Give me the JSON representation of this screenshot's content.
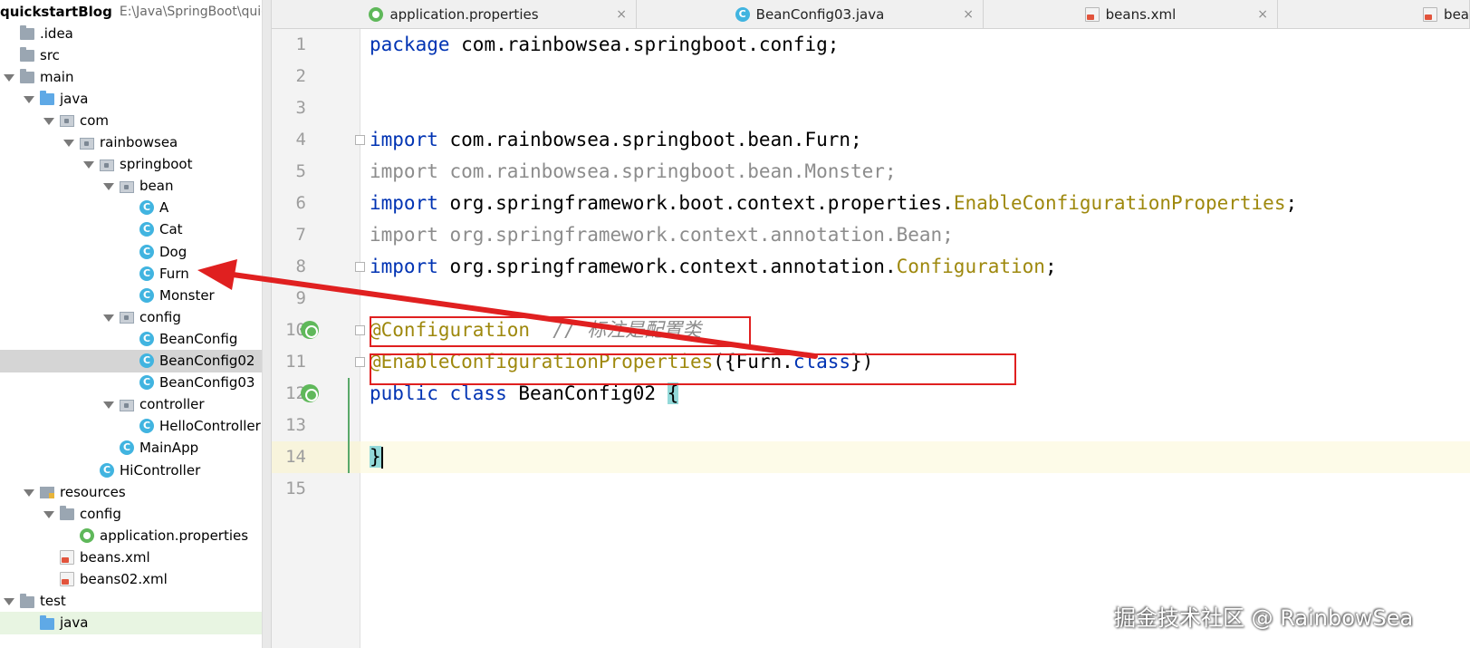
{
  "project": {
    "root_name": "quickstartBlog",
    "root_path": "E:\\Java\\SpringBoot\\quick"
  },
  "tree": [
    {
      "label": ".idea",
      "icon": "folder-icon",
      "arrow": "none"
    },
    {
      "label": "src",
      "icon": "folder-icon",
      "arrow": "none"
    },
    {
      "label": "main",
      "icon": "folder-icon",
      "arrow": "open"
    },
    {
      "label": "java",
      "icon": "source-folder-icon",
      "arrow": "open"
    },
    {
      "label": "com",
      "icon": "package-icon",
      "arrow": "open"
    },
    {
      "label": "rainbowsea",
      "icon": "package-icon",
      "arrow": "open"
    },
    {
      "label": "springboot",
      "icon": "package-icon",
      "arrow": "open"
    },
    {
      "label": "bean",
      "icon": "package-icon",
      "arrow": "open"
    },
    {
      "label": "A",
      "icon": "class-icon",
      "arrow": "none"
    },
    {
      "label": "Cat",
      "icon": "class-icon",
      "arrow": "none"
    },
    {
      "label": "Dog",
      "icon": "class-icon",
      "arrow": "none"
    },
    {
      "label": "Furn",
      "icon": "class-icon",
      "arrow": "none"
    },
    {
      "label": "Monster",
      "icon": "class-icon",
      "arrow": "none"
    },
    {
      "label": "config",
      "icon": "package-icon",
      "arrow": "open"
    },
    {
      "label": "BeanConfig",
      "icon": "class-icon",
      "arrow": "none"
    },
    {
      "label": "BeanConfig02",
      "icon": "class-icon",
      "arrow": "none",
      "selected": true
    },
    {
      "label": "BeanConfig03",
      "icon": "class-icon",
      "arrow": "none"
    },
    {
      "label": "controller",
      "icon": "package-icon",
      "arrow": "open"
    },
    {
      "label": "HelloController",
      "icon": "class-icon",
      "arrow": "none"
    },
    {
      "label": "MainApp",
      "icon": "spring-class-icon",
      "arrow": "none"
    },
    {
      "label": "HiController",
      "icon": "class-icon",
      "arrow": "none"
    },
    {
      "label": "resources",
      "icon": "resources-folder-icon",
      "arrow": "open"
    },
    {
      "label": "config",
      "icon": "folder-icon",
      "arrow": "open"
    },
    {
      "label": "application.properties",
      "icon": "spring-properties-icon",
      "arrow": "none"
    },
    {
      "label": "beans.xml",
      "icon": "xml-file-icon",
      "arrow": "none"
    },
    {
      "label": "beans02.xml",
      "icon": "xml-file-icon",
      "arrow": "none"
    },
    {
      "label": "test",
      "icon": "folder-icon",
      "arrow": "open"
    },
    {
      "label": "java",
      "icon": "source-folder-icon",
      "arrow": "none"
    }
  ],
  "tabs": [
    {
      "label": "application.properties",
      "icon": "spring-properties-icon"
    },
    {
      "label": "BeanConfig03.java",
      "icon": "class-icon"
    },
    {
      "label": "beans.xml",
      "icon": "xml-file-icon"
    },
    {
      "label": "bea",
      "icon": "xml-file-icon"
    }
  ],
  "tab_close_glyph": "×",
  "class_icon_letter": "C",
  "line_numbers": [
    "1",
    "2",
    "3",
    "4",
    "5",
    "6",
    "7",
    "8",
    "9",
    "10",
    "11",
    "12",
    "13",
    "14",
    "15"
  ],
  "code": {
    "l1_kw": "package",
    "l1_rest": " com.rainbowsea.springboot.config;",
    "l4_kw": "import",
    "l4_rest": " com.rainbowsea.springboot.bean.Furn;",
    "l5": "import com.rainbowsea.springboot.bean.Monster;",
    "l6_kw": "import",
    "l6_rest": " org.springframework.boot.context.properties.",
    "l6_ann": "EnableConfigurationProperties",
    "l6_end": ";",
    "l7": "import org.springframework.context.annotation.Bean;",
    "l8_kw": "import",
    "l8_rest": " org.springframework.context.annotation.",
    "l8_ann": "Configuration",
    "l8_end": ";",
    "l10_ann": "@Configuration",
    "l10_cmt": "  // 标注是配置类",
    "l11_ann": "@EnableConfigurationProperties",
    "l11_open": "({Furn.",
    "l11_kw": "class",
    "l11_close": "})",
    "l12_kw": "public class",
    "l12_rest": " BeanConfig02 ",
    "l12_brace": "{",
    "l14_brace": "}"
  },
  "watermark": "掘金技术社区 @ RainbowSea",
  "colors": {
    "keyword": "#0033b3",
    "annotation": "#9e880d",
    "unused_import": "#8c8c8c",
    "highlight_box": "#e02020",
    "arrow": "#e02020"
  }
}
